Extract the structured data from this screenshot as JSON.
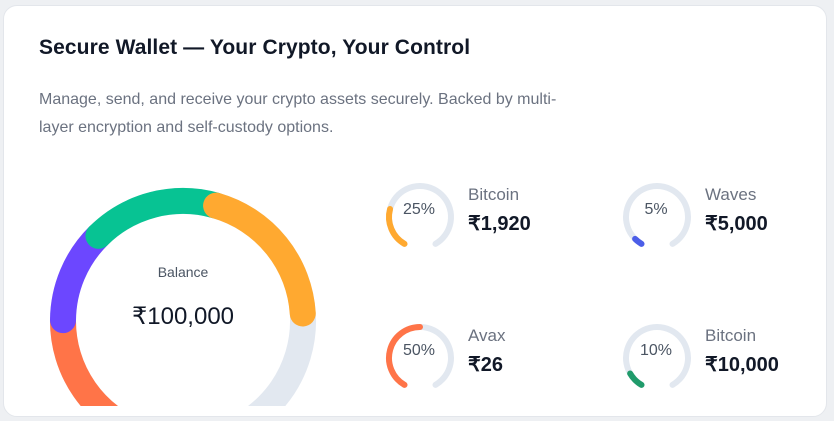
{
  "card": {
    "title": "Secure Wallet — Your Crypto, Your Control",
    "description": "Manage, send, and receive your crypto assets securely. Backed by multi-layer encryption and self-custody options."
  },
  "gauge": {
    "label": "Balance",
    "value": "₹100,000",
    "track_color": "#e2e8f0",
    "segments": [
      {
        "fraction": 0.22,
        "color": "#ff7448"
      },
      {
        "fraction": 0.14,
        "color": "#6c47ff"
      },
      {
        "fraction": 0.19,
        "color": "#07c393"
      },
      {
        "fraction": 0.22,
        "color": "#ffa930"
      }
    ]
  },
  "assets": [
    {
      "name": "Bitcoin",
      "amount": "₹1,920",
      "percent_label": "25%",
      "percent": 25,
      "color": "#ffa930"
    },
    {
      "name": "Waves",
      "amount": "₹5,000",
      "percent_label": "5%",
      "percent": 5,
      "color": "#4c5ee8"
    },
    {
      "name": "Avax",
      "amount": "₹26",
      "percent_label": "50%",
      "percent": 50,
      "color": "#ff7448"
    },
    {
      "name": "Bitcoin",
      "amount": "₹10,000",
      "percent_label": "10%",
      "percent": 10,
      "color": "#209b6b"
    }
  ]
}
